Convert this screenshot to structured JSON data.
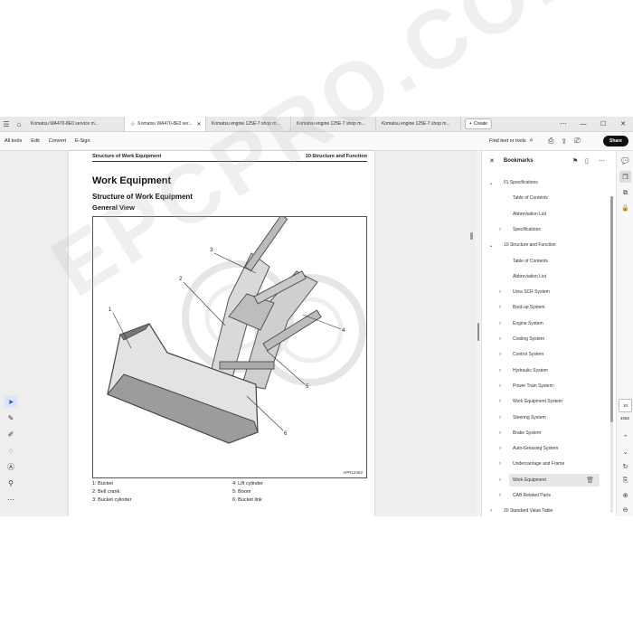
{
  "tabs": {
    "items": [
      {
        "label": "Komatsu WA470-8E0 service m..."
      },
      {
        "label": "Komatsu WA470-8E0 ser..."
      },
      {
        "label": "Komatsu engine 125E-7 shop m..."
      },
      {
        "label": "Komatsu engine 125E-7 shop m..."
      },
      {
        "label": "Komatsu engine 125E-7 shop m..."
      }
    ],
    "create_label": "Create"
  },
  "toolbar": {
    "menu": [
      "All tools",
      "Edit",
      "Convert",
      "E-Sign"
    ],
    "find_label": "Find text or tools",
    "share_label": "Share"
  },
  "document": {
    "running_header_left": "Structure of Work Equipment",
    "running_header_right": "10 Structure and Function",
    "title": "Work Equipment",
    "subtitle": "Structure of Work Equipment",
    "section": "General View",
    "figure_code": "APR12462",
    "callouts": [
      "1",
      "2",
      "3",
      "4",
      "5",
      "6"
    ],
    "legend": [
      "1: Bucket",
      "2: Bell crank",
      "3: Bucket cylinder",
      "4: Lift cylinder",
      "5: Boom",
      "6: Bucket link"
    ]
  },
  "bookmarks": {
    "title": "Bookmarks",
    "items": [
      {
        "label": "01 Specifications",
        "level": 0,
        "chevron": "down"
      },
      {
        "label": "Table of Contents",
        "level": 1,
        "chevron": ""
      },
      {
        "label": "Abbreviation List",
        "level": 1,
        "chevron": ""
      },
      {
        "label": "Specifications",
        "level": 1,
        "chevron": "right"
      },
      {
        "label": "10 Structure and Function",
        "level": 0,
        "chevron": "down"
      },
      {
        "label": "Table of Contents",
        "level": 1,
        "chevron": ""
      },
      {
        "label": "Abbreviation List",
        "level": 1,
        "chevron": ""
      },
      {
        "label": "Urea SCR System",
        "level": 1,
        "chevron": "right"
      },
      {
        "label": "Boot-up System",
        "level": 1,
        "chevron": "right"
      },
      {
        "label": "Engine System",
        "level": 1,
        "chevron": "right"
      },
      {
        "label": "Cooling System",
        "level": 1,
        "chevron": "right"
      },
      {
        "label": "Control System",
        "level": 1,
        "chevron": "right"
      },
      {
        "label": "Hydraulic System",
        "level": 1,
        "chevron": "right"
      },
      {
        "label": "Power Train System",
        "level": 1,
        "chevron": "right"
      },
      {
        "label": "Work Equipment System",
        "level": 1,
        "chevron": "right"
      },
      {
        "label": "Steering System",
        "level": 1,
        "chevron": "right"
      },
      {
        "label": "Brake System",
        "level": 1,
        "chevron": "right"
      },
      {
        "label": "Auto-Greasing System",
        "level": 1,
        "chevron": "right"
      },
      {
        "label": "Undercarriage and Frame",
        "level": 1,
        "chevron": "right"
      },
      {
        "label": "Work Equipment",
        "level": 1,
        "chevron": "right",
        "selected": true
      },
      {
        "label": "CAB Related Parts",
        "level": 1,
        "chevron": "right"
      },
      {
        "label": "20 Standard Value Table",
        "level": 0,
        "chevron": "right"
      }
    ]
  },
  "pager": {
    "current": "10",
    "total": "4062"
  },
  "watermark": "EPCPRO.COM"
}
